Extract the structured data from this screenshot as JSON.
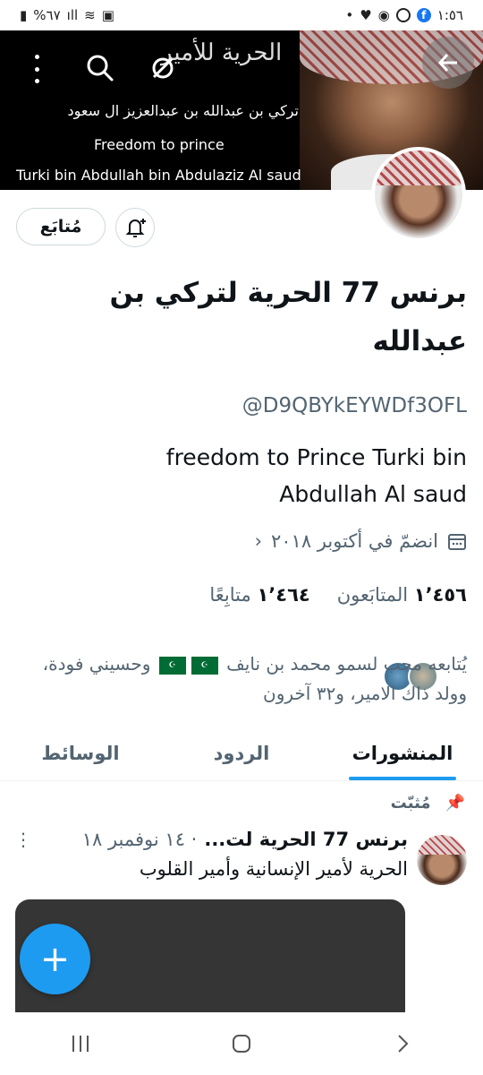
{
  "status_bar": {
    "time": "١:٥٦",
    "battery": "%٦٧"
  },
  "banner": {
    "title": "الحرية للأمير",
    "line1": "تركي بن عبدالله بن عبدالعزيز ال سعود",
    "line2": "Freedom to prince",
    "line3": "Turki bin Abdullah bin Abdulaziz Al saud"
  },
  "actions": {
    "follow_label": "مُتابَع"
  },
  "profile": {
    "display_name": "برنس 77 الحرية لتركي بن عبدالله",
    "handle": "@D9QBYkEYWDf3OFL",
    "bio": "freedom to Prince Turki bin Abdullah Al saud",
    "joined": "انضمّ في أكتوبر ٢٠١٨",
    "followers_count": "١٬٤٥٦",
    "followers_label": "المتابَعون",
    "following_count": "١٬٤٦٤",
    "following_label": "متابِعًا",
    "followed_by_part1": "يُتابعه محب لسمو محمد بن نايف",
    "followed_by_part2": "وحسيني فودة، وولد ذاك الامير، و٣٢ آخرون"
  },
  "tabs": [
    {
      "label": "المنشورات",
      "active": true
    },
    {
      "label": "الردود",
      "active": false
    },
    {
      "label": "الوسائط",
      "active": false
    }
  ],
  "pinned_post": {
    "pinned_label": "مُثبّت",
    "name": "برنس 77 الحرية لت...",
    "date": "· ١٤ نوفمبر ١٨",
    "menu": "⋮",
    "text": "الحرية لأمير الإنسانية وأمير القلوب"
  },
  "fab_label": "+",
  "colors": {
    "accent": "#1d9bf0",
    "text": "#0f1419",
    "secondary": "#536471"
  }
}
